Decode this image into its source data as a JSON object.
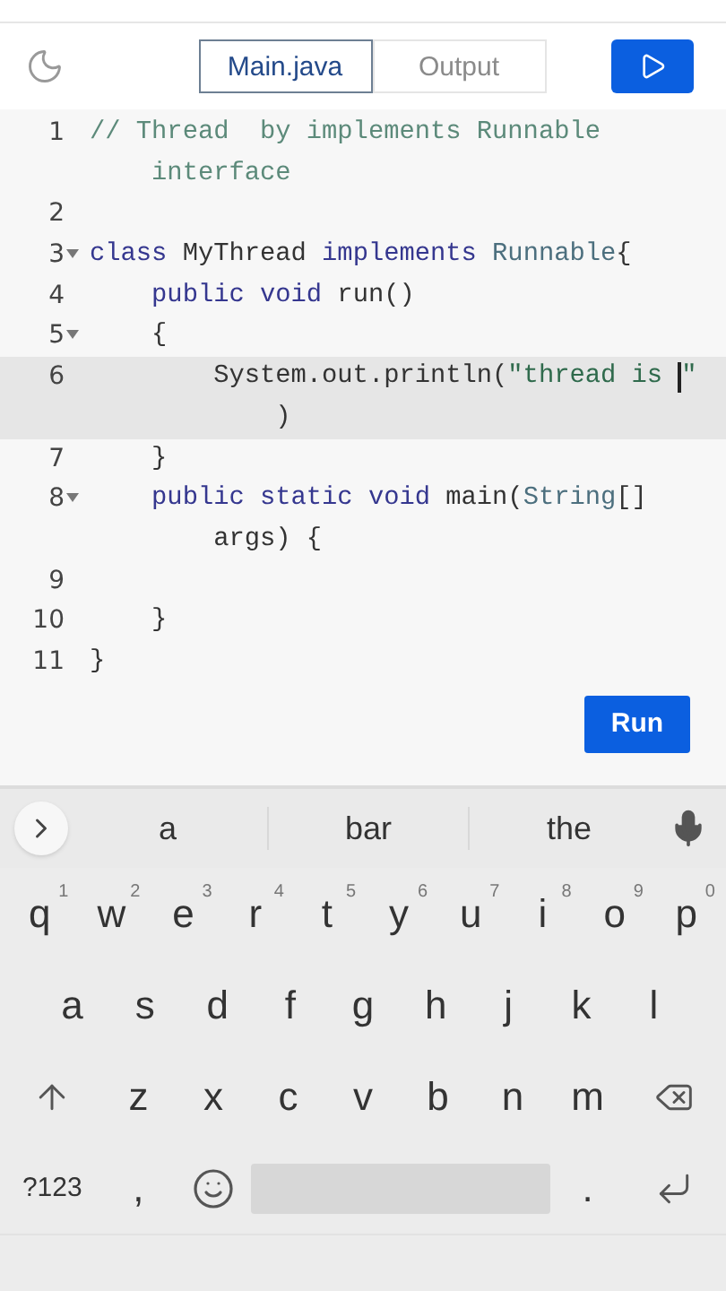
{
  "toolbar": {
    "tabs": [
      {
        "label": "Main.java",
        "selected": true
      },
      {
        "label": "Output",
        "selected": false
      }
    ]
  },
  "editor": {
    "lines": [
      {
        "number": "1",
        "foldable": false,
        "highlighted": false,
        "rows": [
          [
            {
              "kind": "comment",
              "text": "// Thread  by implements Runnable"
            }
          ],
          [
            {
              "kind": "comment",
              "text": "    interface"
            }
          ]
        ]
      },
      {
        "number": "2",
        "foldable": false,
        "highlighted": false,
        "rows": [
          []
        ]
      },
      {
        "number": "3",
        "foldable": true,
        "highlighted": false,
        "rows": [
          [
            {
              "kind": "keyword",
              "text": "class"
            },
            {
              "kind": "plain",
              "text": " MyThread "
            },
            {
              "kind": "keyword",
              "text": "implements"
            },
            {
              "kind": "plain",
              "text": " "
            },
            {
              "kind": "type",
              "text": "Runnable"
            },
            {
              "kind": "plain",
              "text": "{"
            }
          ]
        ]
      },
      {
        "number": "4",
        "foldable": false,
        "highlighted": false,
        "rows": [
          [
            {
              "kind": "plain",
              "text": "    "
            },
            {
              "kind": "keyword",
              "text": "public void"
            },
            {
              "kind": "plain",
              "text": " run()"
            }
          ]
        ]
      },
      {
        "number": "5",
        "foldable": true,
        "highlighted": false,
        "rows": [
          [
            {
              "kind": "plain",
              "text": "    {"
            }
          ]
        ]
      },
      {
        "number": "6",
        "foldable": false,
        "highlighted": true,
        "rows": [
          [
            {
              "kind": "plain",
              "text": "        System.out.println("
            },
            {
              "kind": "string",
              "text": "\"thread is "
            },
            {
              "kind": "cursor",
              "text": ""
            },
            {
              "kind": "string",
              "text": "\""
            }
          ],
          [
            {
              "kind": "plain",
              "text": "            )"
            }
          ]
        ]
      },
      {
        "number": "7",
        "foldable": false,
        "highlighted": false,
        "rows": [
          [
            {
              "kind": "plain",
              "text": "    }"
            }
          ]
        ]
      },
      {
        "number": "8",
        "foldable": true,
        "highlighted": false,
        "rows": [
          [
            {
              "kind": "plain",
              "text": "    "
            },
            {
              "kind": "keyword",
              "text": "public static void"
            },
            {
              "kind": "plain",
              "text": " main("
            },
            {
              "kind": "type",
              "text": "String"
            },
            {
              "kind": "plain",
              "text": "[]"
            }
          ],
          [
            {
              "kind": "plain",
              "text": "        args) {"
            }
          ]
        ]
      },
      {
        "number": "9",
        "foldable": false,
        "highlighted": false,
        "rows": [
          []
        ]
      },
      {
        "number": "10",
        "foldable": false,
        "highlighted": false,
        "rows": [
          [
            {
              "kind": "plain",
              "text": "    }"
            }
          ]
        ]
      },
      {
        "number": "11",
        "foldable": false,
        "highlighted": false,
        "rows": [
          [
            {
              "kind": "plain",
              "text": "}"
            }
          ]
        ]
      }
    ],
    "run_button": "Run"
  },
  "keyboard": {
    "suggestions": [
      "a",
      "bar",
      "the"
    ],
    "rows": [
      {
        "keys": [
          {
            "kind": "char",
            "label": "q",
            "hint": "1"
          },
          {
            "kind": "char",
            "label": "w",
            "hint": "2"
          },
          {
            "kind": "char",
            "label": "e",
            "hint": "3"
          },
          {
            "kind": "char",
            "label": "r",
            "hint": "4"
          },
          {
            "kind": "char",
            "label": "t",
            "hint": "5"
          },
          {
            "kind": "char",
            "label": "y",
            "hint": "6"
          },
          {
            "kind": "char",
            "label": "u",
            "hint": "7"
          },
          {
            "kind": "char",
            "label": "i",
            "hint": "8"
          },
          {
            "kind": "char",
            "label": "o",
            "hint": "9"
          },
          {
            "kind": "char",
            "label": "p",
            "hint": "0"
          }
        ]
      },
      {
        "keys": [
          {
            "kind": "char",
            "label": "a"
          },
          {
            "kind": "char",
            "label": "s"
          },
          {
            "kind": "char",
            "label": "d"
          },
          {
            "kind": "char",
            "label": "f"
          },
          {
            "kind": "char",
            "label": "g"
          },
          {
            "kind": "char",
            "label": "h"
          },
          {
            "kind": "char",
            "label": "j"
          },
          {
            "kind": "char",
            "label": "k"
          },
          {
            "kind": "char",
            "label": "l"
          }
        ]
      },
      {
        "keys": [
          {
            "kind": "shift"
          },
          {
            "kind": "char",
            "label": "z"
          },
          {
            "kind": "char",
            "label": "x"
          },
          {
            "kind": "char",
            "label": "c"
          },
          {
            "kind": "char",
            "label": "v"
          },
          {
            "kind": "char",
            "label": "b"
          },
          {
            "kind": "char",
            "label": "n"
          },
          {
            "kind": "char",
            "label": "m"
          },
          {
            "kind": "backspace"
          }
        ]
      },
      {
        "keys": [
          {
            "kind": "symbols",
            "label": "?123"
          },
          {
            "kind": "char",
            "label": ","
          },
          {
            "kind": "emoji"
          },
          {
            "kind": "space"
          },
          {
            "kind": "char",
            "label": "."
          },
          {
            "kind": "enter"
          }
        ]
      }
    ]
  }
}
